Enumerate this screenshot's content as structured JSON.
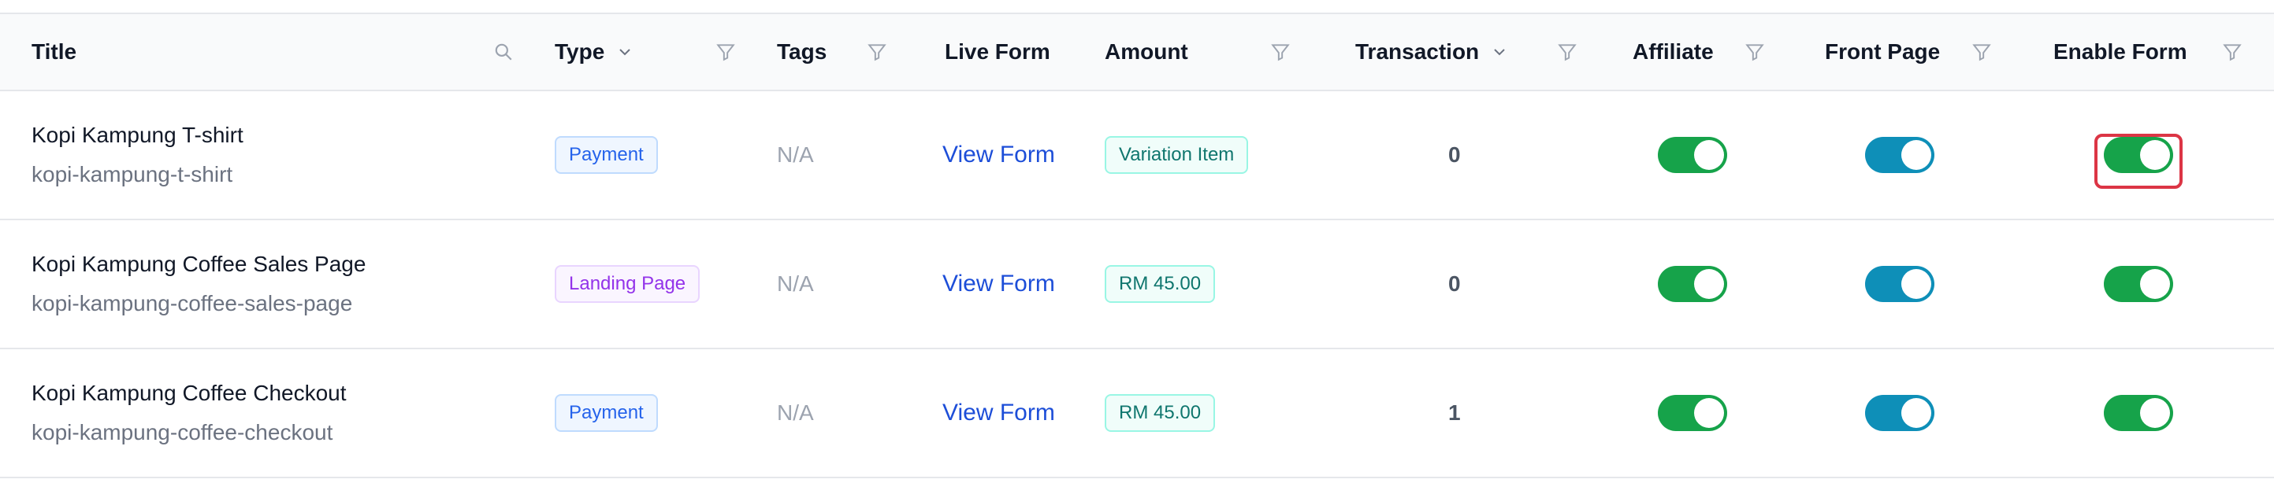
{
  "columns": {
    "title": "Title",
    "type": "Type",
    "tags": "Tags",
    "live_form": "Live Form",
    "amount": "Amount",
    "transaction": "Transaction",
    "affiliate": "Affiliate",
    "front_page": "Front Page",
    "enable_form": "Enable Form"
  },
  "rows": [
    {
      "title": "Kopi Kampung T-shirt",
      "slug": "kopi-kampung-t-shirt",
      "type": "Payment",
      "tags": "N/A",
      "live_form": "View Form",
      "amount": "Variation Item",
      "transaction": "0",
      "affiliate": true,
      "front_page": true,
      "enable_form": true
    },
    {
      "title": "Kopi Kampung Coffee Sales Page",
      "slug": "kopi-kampung-coffee-sales-page",
      "type": "Landing Page",
      "tags": "N/A",
      "live_form": "View Form",
      "amount": "RM 45.00",
      "transaction": "0",
      "affiliate": true,
      "front_page": true,
      "enable_form": true
    },
    {
      "title": "Kopi Kampung Coffee Checkout",
      "slug": "kopi-kampung-coffee-checkout",
      "type": "Payment",
      "tags": "N/A",
      "live_form": "View Form",
      "amount": "RM 45.00",
      "transaction": "1",
      "affiliate": true,
      "front_page": true,
      "enable_form": true
    }
  ],
  "colors": {
    "toggle_green": "#16a34a",
    "toggle_blue": "#0e8fb8",
    "highlight": "#dc3545",
    "link": "#1d4ed8"
  }
}
